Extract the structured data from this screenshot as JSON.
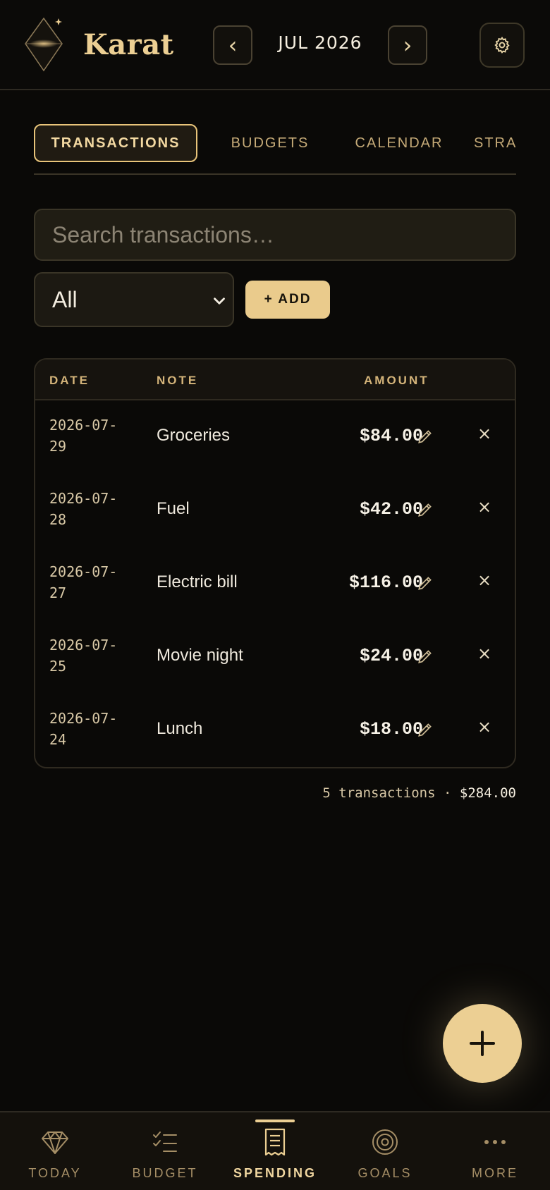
{
  "app": {
    "title": "Karat"
  },
  "header": {
    "month": "JUL 2026",
    "prev_label": "‹",
    "next_label": "›"
  },
  "tabs": [
    {
      "label": "TRANSACTIONS",
      "active": true
    },
    {
      "label": "BUDGETS"
    },
    {
      "label": "CALENDAR"
    },
    {
      "label": "STRAT"
    }
  ],
  "search": {
    "placeholder": "Search transactions…"
  },
  "filter": {
    "selected": "All"
  },
  "add_button": {
    "label": "+ ADD"
  },
  "table": {
    "columns": [
      "DATE",
      "NOTE",
      "AMOUNT"
    ],
    "rows": [
      {
        "date": "2026-07-29",
        "note": "Groceries",
        "amount": "$84.00"
      },
      {
        "date": "2026-07-28",
        "note": "Fuel",
        "amount": "$42.00"
      },
      {
        "date": "2026-07-27",
        "note": "Electric bill",
        "amount": "$116.00"
      },
      {
        "date": "2026-07-25",
        "note": "Movie night",
        "amount": "$24.00"
      },
      {
        "date": "2026-07-24",
        "note": "Lunch",
        "amount": "$18.00"
      }
    ],
    "delete_label": "×"
  },
  "summary": {
    "count_text": "5 transactions",
    "separator": "·",
    "total": "$284.00"
  },
  "bottom_nav": [
    {
      "label": "TODAY",
      "icon": "diamond-icon"
    },
    {
      "label": "BUDGET",
      "icon": "checklist-icon"
    },
    {
      "label": "SPENDING",
      "icon": "receipt-icon",
      "active": true
    },
    {
      "label": "GOALS",
      "icon": "target-icon"
    },
    {
      "label": "MORE",
      "icon": "more-icon"
    }
  ],
  "colors": {
    "accent": "#eccf93",
    "background": "#0a0907"
  }
}
